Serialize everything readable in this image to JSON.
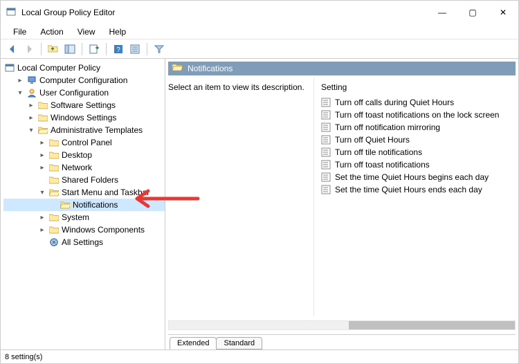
{
  "window": {
    "title": "Local Group Policy Editor"
  },
  "winctrl": {
    "min": "—",
    "max": "▢",
    "close": "✕"
  },
  "menubar": [
    "File",
    "Action",
    "View",
    "Help"
  ],
  "tree": {
    "root": "Local Computer Policy",
    "cc": "Computer Configuration",
    "uc": "User Configuration",
    "ss": "Software Settings",
    "ws": "Windows Settings",
    "at": "Administrative Templates",
    "cp": "Control Panel",
    "dk": "Desktop",
    "nw": "Network",
    "sf": "Shared Folders",
    "smt": "Start Menu and Taskbar",
    "notif": "Notifications",
    "sys": "System",
    "wc": "Windows Components",
    "as": "All Settings"
  },
  "detail": {
    "header": "Notifications",
    "desc": "Select an item to view its description.",
    "colhdr": "Setting",
    "items": [
      "Turn off calls during Quiet Hours",
      "Turn off toast notifications on the lock screen",
      "Turn off notification mirroring",
      "Turn off Quiet Hours",
      "Turn off tile notifications",
      "Turn off toast notifications",
      "Set the time Quiet Hours begins each day",
      "Set the time Quiet Hours ends each day"
    ]
  },
  "tabs": {
    "ext": "Extended",
    "std": "Standard"
  },
  "status": "8 setting(s)"
}
